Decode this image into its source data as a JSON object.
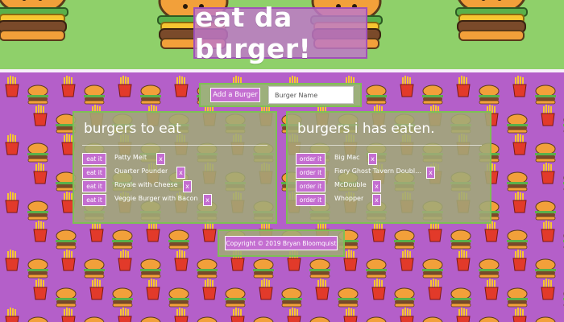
{
  "header": {
    "title": "eat da burger!"
  },
  "form": {
    "add_label": "Add a Burger",
    "input_placeholder": "Burger Name",
    "input_value": ""
  },
  "to_eat": {
    "title": "burgers to eat",
    "action_label": "eat it",
    "delete_label": "x",
    "items": [
      {
        "name": "Patty Melt"
      },
      {
        "name": "Quarter Pounder"
      },
      {
        "name": "Royale with Cheese"
      },
      {
        "name": "Veggie Burger with Bacon"
      }
    ]
  },
  "eaten": {
    "title": "burgers i has eaten.",
    "action_label": "order it",
    "delete_label": "x",
    "items": [
      {
        "name": "Big Mac"
      },
      {
        "name": "Fiery Ghost Tavern Double ..."
      },
      {
        "name": "McDouble"
      },
      {
        "name": "Whopper"
      }
    ]
  },
  "footer": {
    "copyright": "Copyright © 2019 Bryan Bloomquist"
  },
  "colors": {
    "header_bg": "#8fd06a",
    "page_bg": "#b45fc9",
    "button_bg": "#c46ed1",
    "panel_border": "#7fbf55"
  }
}
